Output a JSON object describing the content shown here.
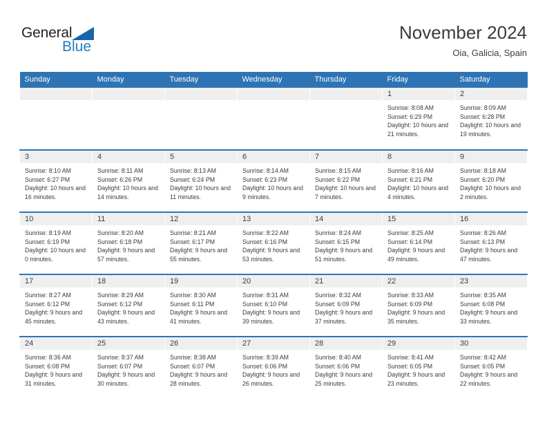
{
  "brand": {
    "name_part1": "General",
    "name_part2": "Blue",
    "triangle_color": "#1565a8",
    "blue_color": "#1f7ec4"
  },
  "header": {
    "title": "November 2024",
    "subtitle": "Oia, Galicia, Spain",
    "accent_color": "#2e74b5",
    "band_color": "#efefef"
  },
  "weekday_headers": [
    "Sunday",
    "Monday",
    "Tuesday",
    "Wednesday",
    "Thursday",
    "Friday",
    "Saturday"
  ],
  "weeks": [
    [
      {
        "day": "",
        "sunrise": "",
        "sunset": "",
        "daylight": "",
        "blank": true
      },
      {
        "day": "",
        "sunrise": "",
        "sunset": "",
        "daylight": "",
        "blank": true
      },
      {
        "day": "",
        "sunrise": "",
        "sunset": "",
        "daylight": "",
        "blank": true
      },
      {
        "day": "",
        "sunrise": "",
        "sunset": "",
        "daylight": "",
        "blank": true
      },
      {
        "day": "",
        "sunrise": "",
        "sunset": "",
        "daylight": "",
        "blank": true
      },
      {
        "day": "1",
        "sunrise": "Sunrise: 8:08 AM",
        "sunset": "Sunset: 6:29 PM",
        "daylight": "Daylight: 10 hours and 21 minutes."
      },
      {
        "day": "2",
        "sunrise": "Sunrise: 8:09 AM",
        "sunset": "Sunset: 6:28 PM",
        "daylight": "Daylight: 10 hours and 19 minutes."
      }
    ],
    [
      {
        "day": "3",
        "sunrise": "Sunrise: 8:10 AM",
        "sunset": "Sunset: 6:27 PM",
        "daylight": "Daylight: 10 hours and 16 minutes."
      },
      {
        "day": "4",
        "sunrise": "Sunrise: 8:11 AM",
        "sunset": "Sunset: 6:26 PM",
        "daylight": "Daylight: 10 hours and 14 minutes."
      },
      {
        "day": "5",
        "sunrise": "Sunrise: 8:13 AM",
        "sunset": "Sunset: 6:24 PM",
        "daylight": "Daylight: 10 hours and 11 minutes."
      },
      {
        "day": "6",
        "sunrise": "Sunrise: 8:14 AM",
        "sunset": "Sunset: 6:23 PM",
        "daylight": "Daylight: 10 hours and 9 minutes."
      },
      {
        "day": "7",
        "sunrise": "Sunrise: 8:15 AM",
        "sunset": "Sunset: 6:22 PM",
        "daylight": "Daylight: 10 hours and 7 minutes."
      },
      {
        "day": "8",
        "sunrise": "Sunrise: 8:16 AM",
        "sunset": "Sunset: 6:21 PM",
        "daylight": "Daylight: 10 hours and 4 minutes."
      },
      {
        "day": "9",
        "sunrise": "Sunrise: 8:18 AM",
        "sunset": "Sunset: 6:20 PM",
        "daylight": "Daylight: 10 hours and 2 minutes."
      }
    ],
    [
      {
        "day": "10",
        "sunrise": "Sunrise: 8:19 AM",
        "sunset": "Sunset: 6:19 PM",
        "daylight": "Daylight: 10 hours and 0 minutes."
      },
      {
        "day": "11",
        "sunrise": "Sunrise: 8:20 AM",
        "sunset": "Sunset: 6:18 PM",
        "daylight": "Daylight: 9 hours and 57 minutes."
      },
      {
        "day": "12",
        "sunrise": "Sunrise: 8:21 AM",
        "sunset": "Sunset: 6:17 PM",
        "daylight": "Daylight: 9 hours and 55 minutes."
      },
      {
        "day": "13",
        "sunrise": "Sunrise: 8:22 AM",
        "sunset": "Sunset: 6:16 PM",
        "daylight": "Daylight: 9 hours and 53 minutes."
      },
      {
        "day": "14",
        "sunrise": "Sunrise: 8:24 AM",
        "sunset": "Sunset: 6:15 PM",
        "daylight": "Daylight: 9 hours and 51 minutes."
      },
      {
        "day": "15",
        "sunrise": "Sunrise: 8:25 AM",
        "sunset": "Sunset: 6:14 PM",
        "daylight": "Daylight: 9 hours and 49 minutes."
      },
      {
        "day": "16",
        "sunrise": "Sunrise: 8:26 AM",
        "sunset": "Sunset: 6:13 PM",
        "daylight": "Daylight: 9 hours and 47 minutes."
      }
    ],
    [
      {
        "day": "17",
        "sunrise": "Sunrise: 8:27 AM",
        "sunset": "Sunset: 6:12 PM",
        "daylight": "Daylight: 9 hours and 45 minutes."
      },
      {
        "day": "18",
        "sunrise": "Sunrise: 8:29 AM",
        "sunset": "Sunset: 6:12 PM",
        "daylight": "Daylight: 9 hours and 43 minutes."
      },
      {
        "day": "19",
        "sunrise": "Sunrise: 8:30 AM",
        "sunset": "Sunset: 6:11 PM",
        "daylight": "Daylight: 9 hours and 41 minutes."
      },
      {
        "day": "20",
        "sunrise": "Sunrise: 8:31 AM",
        "sunset": "Sunset: 6:10 PM",
        "daylight": "Daylight: 9 hours and 39 minutes."
      },
      {
        "day": "21",
        "sunrise": "Sunrise: 8:32 AM",
        "sunset": "Sunset: 6:09 PM",
        "daylight": "Daylight: 9 hours and 37 minutes."
      },
      {
        "day": "22",
        "sunrise": "Sunrise: 8:33 AM",
        "sunset": "Sunset: 6:09 PM",
        "daylight": "Daylight: 9 hours and 35 minutes."
      },
      {
        "day": "23",
        "sunrise": "Sunrise: 8:35 AM",
        "sunset": "Sunset: 6:08 PM",
        "daylight": "Daylight: 9 hours and 33 minutes."
      }
    ],
    [
      {
        "day": "24",
        "sunrise": "Sunrise: 8:36 AM",
        "sunset": "Sunset: 6:08 PM",
        "daylight": "Daylight: 9 hours and 31 minutes."
      },
      {
        "day": "25",
        "sunrise": "Sunrise: 8:37 AM",
        "sunset": "Sunset: 6:07 PM",
        "daylight": "Daylight: 9 hours and 30 minutes."
      },
      {
        "day": "26",
        "sunrise": "Sunrise: 8:38 AM",
        "sunset": "Sunset: 6:07 PM",
        "daylight": "Daylight: 9 hours and 28 minutes."
      },
      {
        "day": "27",
        "sunrise": "Sunrise: 8:39 AM",
        "sunset": "Sunset: 6:06 PM",
        "daylight": "Daylight: 9 hours and 26 minutes."
      },
      {
        "day": "28",
        "sunrise": "Sunrise: 8:40 AM",
        "sunset": "Sunset: 6:06 PM",
        "daylight": "Daylight: 9 hours and 25 minutes."
      },
      {
        "day": "29",
        "sunrise": "Sunrise: 8:41 AM",
        "sunset": "Sunset: 6:05 PM",
        "daylight": "Daylight: 9 hours and 23 minutes."
      },
      {
        "day": "30",
        "sunrise": "Sunrise: 8:42 AM",
        "sunset": "Sunset: 6:05 PM",
        "daylight": "Daylight: 9 hours and 22 minutes."
      }
    ]
  ]
}
